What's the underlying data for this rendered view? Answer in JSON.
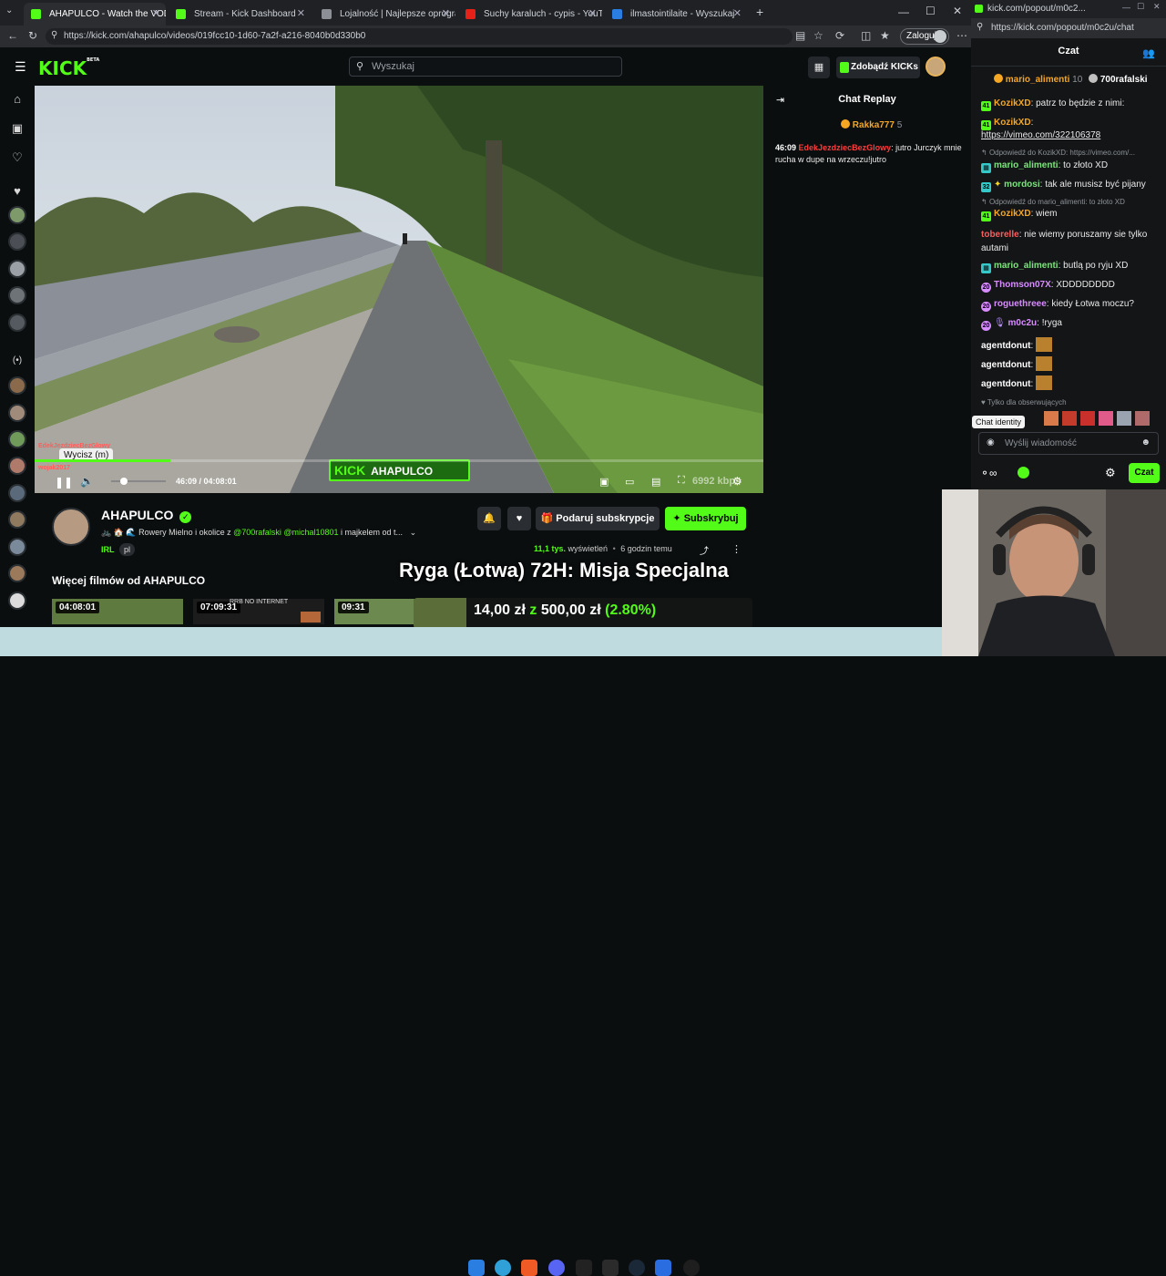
{
  "browser": {
    "tabs": [
      {
        "label": "AHAPULCO - Watch the VOD",
        "active": true
      },
      {
        "label": "Stream - Kick Dashboard",
        "active": false
      },
      {
        "label": "Lojalność | Najlepsze oprogramow",
        "active": false
      },
      {
        "label": "Suchy karaluch - cypis - YouTube",
        "active": false
      },
      {
        "label": "ilmastointilaite - Wyszukaj",
        "active": false
      }
    ],
    "url": "https://kick.com/ahapulco/videos/019fcc10-1d60-7a2f-a216-8040b0d330b0",
    "login_label": "Zaloguj"
  },
  "kick": {
    "logo": "KICK",
    "logo_sup": "BETA",
    "search_placeholder": "Wyszukaj",
    "get_kicks": "Zdobądź KICKs"
  },
  "player": {
    "overlay_chat": [
      "EdekJezdziecBezGlowy",
      "Wycisz (m)",
      "wojak2017"
    ],
    "tooltip": "Wycisz (m)",
    "time_current": "46:09",
    "time_total": "04:08:01",
    "bitrate": "6992 kbps",
    "kick_banner": "KICK",
    "kick_banner_channel": "AHAPULCO",
    "progress": 0.186
  },
  "replay": {
    "title": "Chat Replay",
    "top_user": "Rakka777",
    "top_count": "5",
    "messages": [
      {
        "time": "46:09",
        "user": "EdekJezdziecBezGlowy",
        "text": "jutro Jurczyk mnie rucha w dupe na wrzeczu!jutro"
      }
    ]
  },
  "channel": {
    "name": "AHAPULCO",
    "desc_prefix": "🚲 🏠 🌊 Rowery Mielno i okolice z ",
    "mention1": "@700rafalski",
    "mention2": "@michal10801",
    "desc_suffix": " i majkelem od t...",
    "category": "IRL",
    "lang": "pl",
    "views_num": "11,1 tys.",
    "views_label": "wyświetleń",
    "ago": "6 godzin temu",
    "gift_sub": "Podaruj subskrypcje",
    "subscribe": "Subskrybuj"
  },
  "more_videos": {
    "title": "Więcej filmów od AHAPULCO",
    "items": [
      {
        "duration": "04:08:01"
      },
      {
        "duration": "07:09:31",
        "caption": "RRB NO INTERNET"
      },
      {
        "duration": "09:31"
      }
    ]
  },
  "stream_overlay": {
    "title": "Ryga (Łotwa) 72H: Misja Specjalna",
    "amount": "14,00 zł",
    "goal_sep": "z",
    "goal": "500,00 zł",
    "percent": "(2.80%)"
  },
  "popout": {
    "url": "https://kick.com/popout/m0c2u/chat",
    "title_tab": "kick.com/popout/m0c2...",
    "header": "Czat",
    "top_users": [
      {
        "name": "mario_alimenti",
        "count": "10"
      },
      {
        "name": "700rafalski",
        "count": "5"
      }
    ],
    "messages": [
      {
        "user": "KozikXD",
        "color": "#f5a623",
        "text": "patrz to będzie z nimi:",
        "reply": ""
      },
      {
        "user": "KozikXD",
        "color": "#f5a623",
        "text": "",
        "reply": ""
      },
      {
        "user": "",
        "color": "",
        "text": "https://vimeo.com/322106378",
        "reply": ""
      },
      {
        "user": "mario_alimenti",
        "color": "#7ee37e",
        "text": "to złoto XD",
        "reply": "Odpowiedź do KozikXD: https://vimeo.com/..."
      },
      {
        "user": "mordosi",
        "color": "#7ee37e",
        "text": "tak ale musisz być pijany",
        "reply": ""
      },
      {
        "user": "KozikXD",
        "color": "#f5a623",
        "text": "wiem",
        "reply": "Odpowiedź do mario_alimenti: to złoto XD"
      },
      {
        "user": "toberelle",
        "color": "#ff5c5c",
        "text": "nie wiemy poruszamy sie tylko autami",
        "reply": ""
      },
      {
        "user": "mario_alimenti",
        "color": "#7ee37e",
        "text": "butlą po ryju XD",
        "reply": ""
      },
      {
        "user": "Thomson07X",
        "color": "#d78cff",
        "text": "XDDDDDDDD",
        "reply": ""
      },
      {
        "user": "roguethreee",
        "color": "#d78cff",
        "text": "kiedy Łotwa moczu?",
        "reply": ""
      },
      {
        "user": "m0c2u",
        "color": "#d78cff",
        "text": "!ryga",
        "reply": ""
      },
      {
        "user": "agentdonut",
        "color": "#ffffff",
        "text": "",
        "reply": ""
      },
      {
        "user": "agentdonut",
        "color": "#ffffff",
        "text": "",
        "reply": ""
      },
      {
        "user": "agentdonut",
        "color": "#ffffff",
        "text": "",
        "reply": ""
      }
    ],
    "followers_only": "Tylko dla obserwujących",
    "chat_identity": "Chat identity",
    "input_placeholder": "Wyślij wiadomość",
    "send": "Czat"
  }
}
